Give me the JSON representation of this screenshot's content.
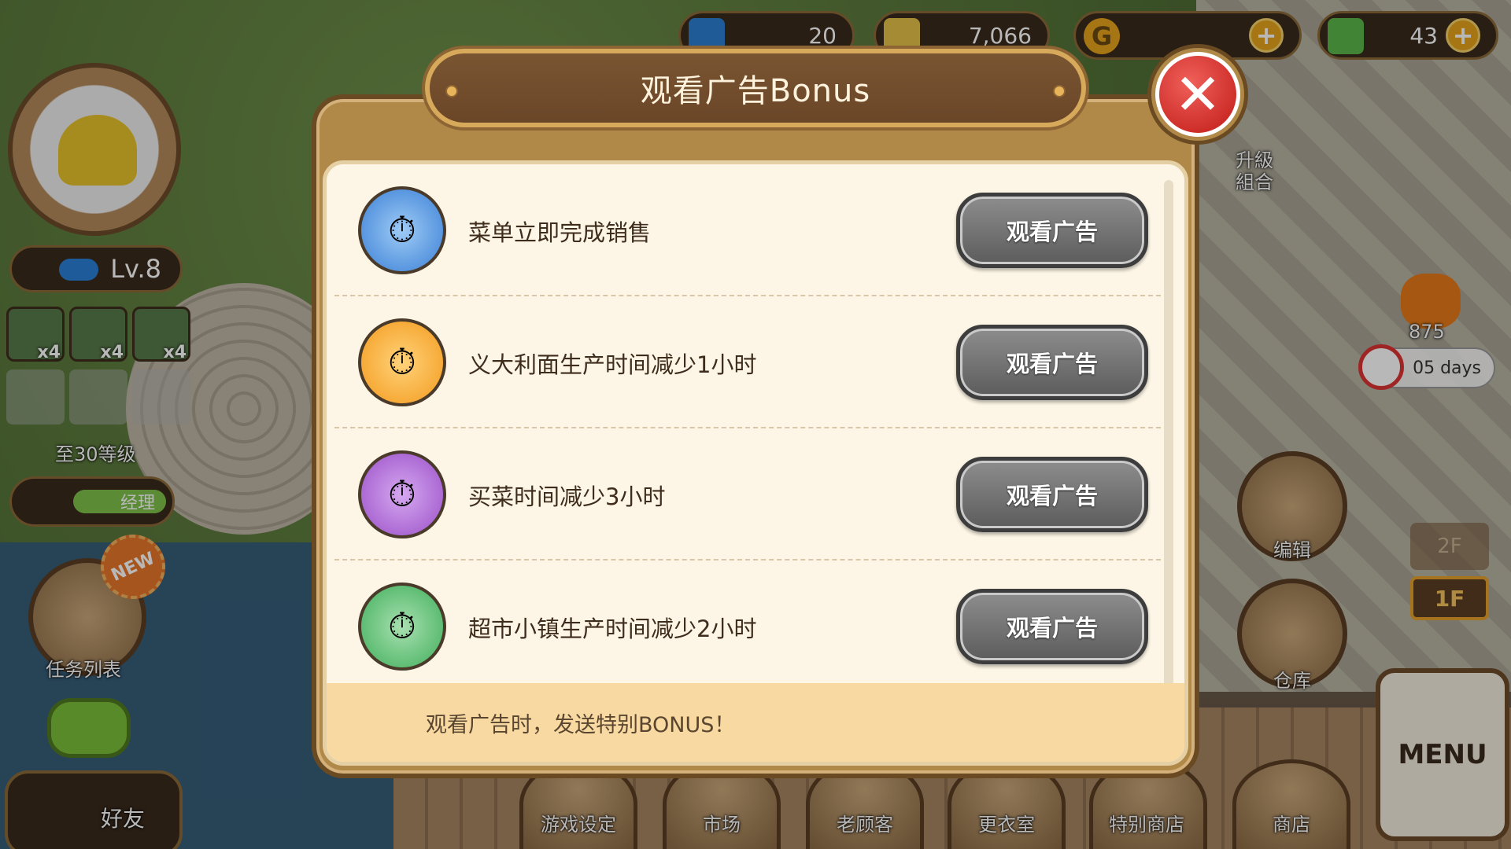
{
  "resources": [
    {
      "value": "20",
      "icon": "lego-brick-icon",
      "color": "#2b7fd1"
    },
    {
      "value": "7,066",
      "icon": "pasta-icon",
      "color": "#e7c14a"
    },
    {
      "value": "G",
      "icon": "gold-coin-icon",
      "color": "#e7a41c"
    },
    {
      "value": "43",
      "icon": "cash-icon",
      "color": "#5ab84a"
    }
  ],
  "hud": {
    "level": "Lv.8",
    "boosts": [
      "x4",
      "x4",
      "x4"
    ],
    "to_level": "至30等级",
    "manager": "经理",
    "new_badge": "NEW",
    "quest_list": "任务列表",
    "friends": "好友",
    "upgrade_combo_1": "升級",
    "upgrade_combo_2": "組合",
    "event_count": "875",
    "event_days": "05 days",
    "edit": "编辑",
    "storage": "仓库",
    "floor2": "2F",
    "floor1": "1F",
    "menu": "MENU",
    "bottom": [
      "游戏设定",
      "市场",
      "老顾客",
      "更衣室",
      "特别商店",
      "商店"
    ]
  },
  "dialog": {
    "title": "观看广告Bonus",
    "items": [
      {
        "label": "菜单立即完成销售",
        "button": "观看广告",
        "icon": "timer-cloche-icon",
        "color": "#3a7fd6"
      },
      {
        "label": "义大利面生产时间减少1小时",
        "button": "观看广告",
        "icon": "pasta-timer-icon",
        "color": "#f39a1c"
      },
      {
        "label": "买菜时间减少3小时",
        "button": "观看广告",
        "icon": "grocery-bag-timer-icon",
        "color": "#9a4fc8"
      },
      {
        "label": "超市小镇生产时间减少2小时",
        "button": "观看广告",
        "icon": "meat-timer-icon",
        "color": "#3fae5a"
      }
    ],
    "footer": "观看广告时，发送特别BONUS！"
  }
}
